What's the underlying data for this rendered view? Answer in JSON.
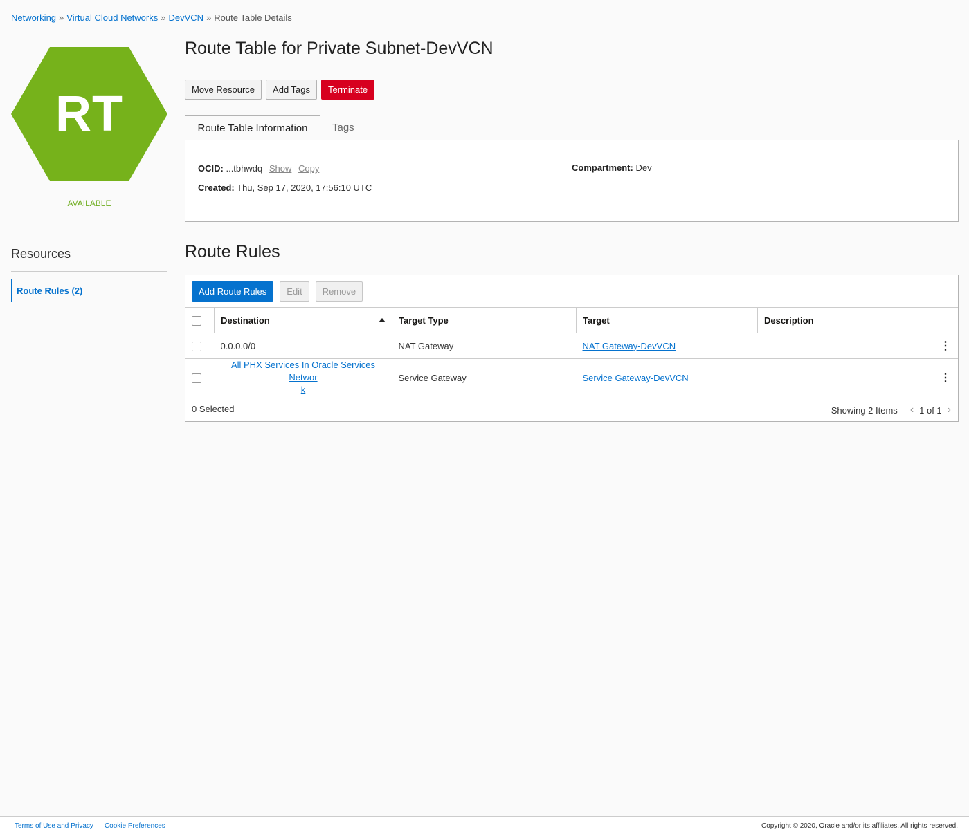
{
  "breadcrumb": {
    "items": [
      "Networking",
      "Virtual Cloud Networks",
      "DevVCN"
    ],
    "separator": "»",
    "current": "Route Table Details"
  },
  "resource": {
    "initials": "RT",
    "status": "AVAILABLE",
    "hex_color": "#76b21b"
  },
  "resources": {
    "title": "Resources",
    "route_rules_link": "Route Rules (2)"
  },
  "page": {
    "title": "Route Table for Private Subnet-DevVCN",
    "actions": {
      "move": "Move Resource",
      "tags": "Add Tags",
      "terminate": "Terminate"
    }
  },
  "tabs": {
    "info": "Route Table Information",
    "tags": "Tags"
  },
  "info": {
    "ocid_label": "OCID:",
    "ocid_value": "...tbhwdq",
    "show": "Show",
    "copy": "Copy",
    "created_label": "Created:",
    "created_value": "Thu, Sep 17, 2020, 17:56:10 UTC",
    "compartment_label": "Compartment:",
    "compartment_value": "Dev"
  },
  "route_rules": {
    "title": "Route Rules",
    "buttons": {
      "add": "Add Route Rules",
      "edit": "Edit",
      "remove": "Remove"
    },
    "columns": {
      "destination": "Destination",
      "target_type": "Target Type",
      "target": "Target",
      "description": "Description"
    },
    "rows": [
      {
        "destination": "0.0.0.0/0",
        "target_type": "NAT Gateway",
        "target": "NAT Gateway-DevVCN",
        "description": ""
      },
      {
        "destination_line1": "All PHX Services In Oracle Services Networ",
        "destination_line2": "k",
        "target_type": "Service Gateway",
        "target": "Service Gateway-DevVCN",
        "description": ""
      }
    ],
    "selected": "0 Selected",
    "showing": "Showing 2 Items",
    "page": "1 of 1"
  },
  "footer": {
    "terms": "Terms of Use and Privacy",
    "cookies": "Cookie Preferences",
    "copyright": "Copyright © 2020, Oracle and/or its affiliates. All rights reserved."
  }
}
